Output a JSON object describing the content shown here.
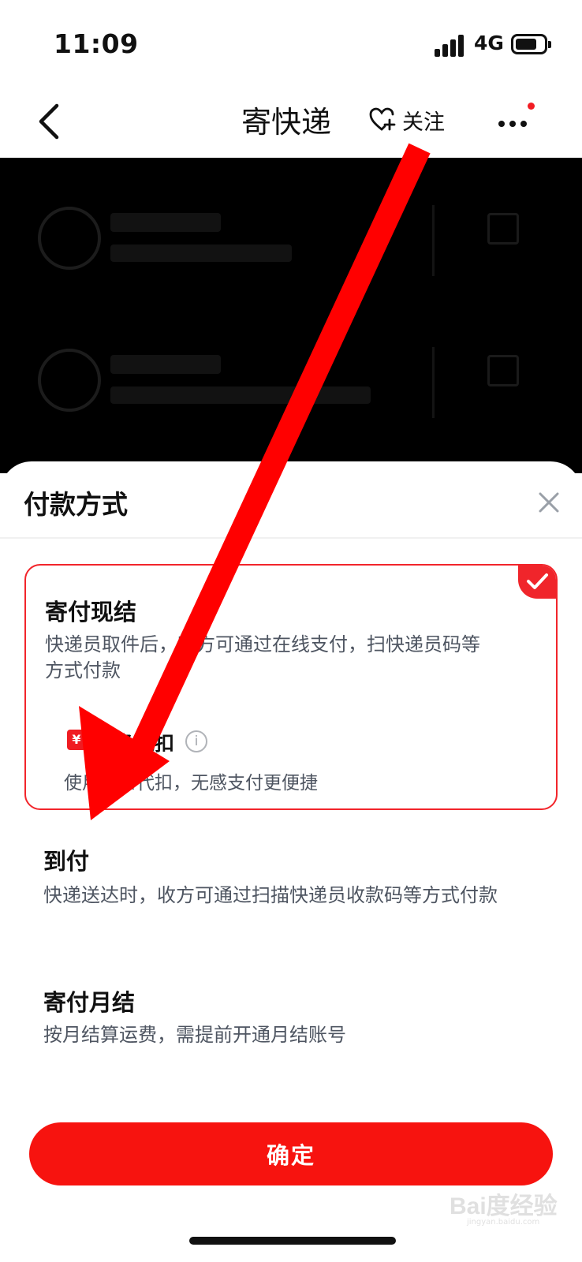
{
  "status_bar": {
    "time": "11:09",
    "network": "4G",
    "signal_icon": "signal-bars-icon",
    "battery_icon": "battery-icon"
  },
  "nav": {
    "title": "寄快递",
    "follow_label": "关注",
    "back_icon": "chevron-left-icon",
    "follow_icon": "heart-plus-icon",
    "more_icon": "more-dots-icon",
    "notification_dot_color": "#f21c23"
  },
  "sheet": {
    "title": "付款方式",
    "close_icon": "close-icon",
    "options": [
      {
        "title": "寄付现结",
        "desc_line1": "快递员取件后，寄方可通过在线支付，扫快递员码等",
        "desc_line2": "方式付款",
        "selected": true,
        "sub": {
          "badge": "¥",
          "title": "白条代扣",
          "info": "i",
          "desc": "使用白条代扣，无感支付更便捷"
        }
      },
      {
        "title": "到付",
        "desc": "快递送达时，收方可通过扫描快递员收款码等方式付款",
        "selected": false
      },
      {
        "title": "寄付月结",
        "desc": "按月结算运费，需提前开通月结账号",
        "selected": false
      }
    ],
    "confirm_label": "确定"
  },
  "watermark": {
    "text": "Bai度经验",
    "sub": "jingyan.baidu.com"
  },
  "colors": {
    "accent": "#f7130f",
    "selected_border": "#f2252b",
    "annotation_arrow": "#ff0000"
  }
}
